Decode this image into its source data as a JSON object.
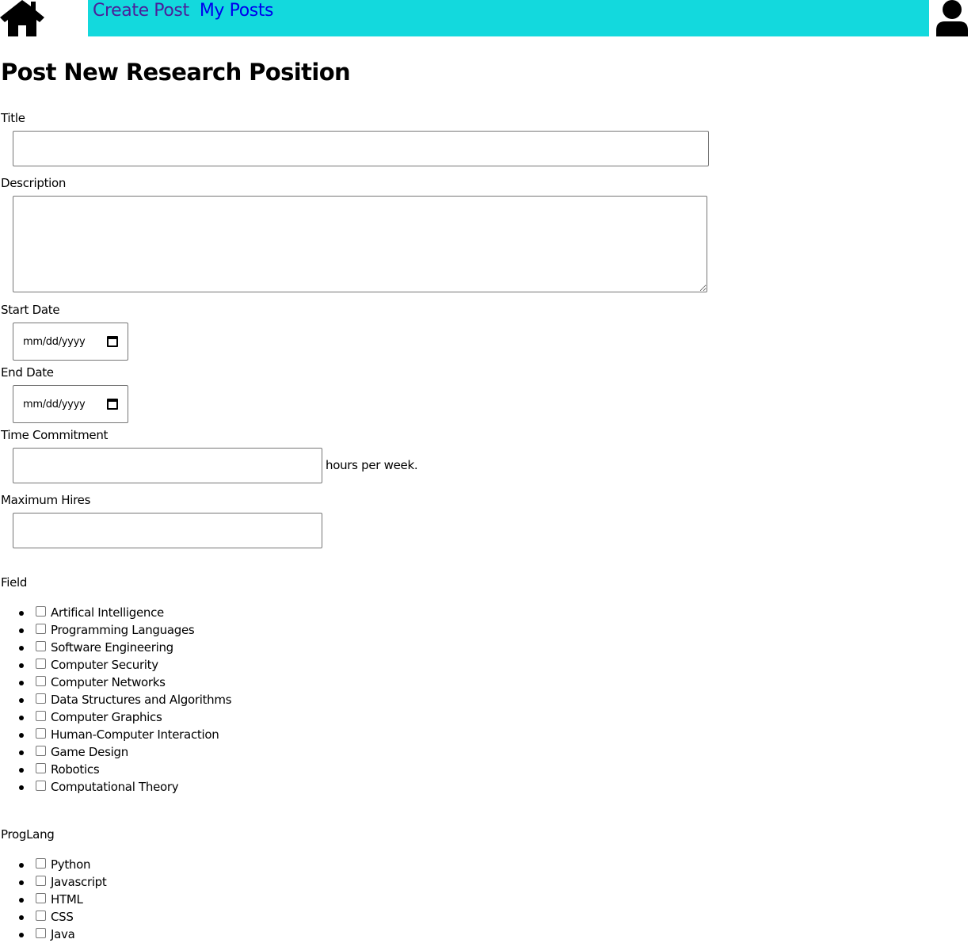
{
  "nav": {
    "home_icon": "home-icon",
    "create_post": "Create Post",
    "my_posts": "My Posts",
    "user_icon": "user-icon",
    "bar_color": "#13d9dd"
  },
  "page_title": "Post New Research Position",
  "form": {
    "title_label": "Title",
    "title_value": "",
    "description_label": "Description",
    "description_value": "",
    "start_date_label": "Start Date",
    "start_date_placeholder": "mm/dd/yyyy",
    "end_date_label": "End Date",
    "end_date_placeholder": "mm/dd/yyyy",
    "time_commitment_label": "Time Commitment",
    "time_commitment_value": "",
    "time_commitment_suffix": "hours per week.",
    "max_hires_label": "Maximum Hires",
    "max_hires_value": "",
    "field_label": "Field",
    "fields": [
      "Artifical Intelligence",
      "Programming Languages",
      "Software Engineering",
      "Computer Security",
      "Computer Networks",
      "Data Structures and Algorithms",
      "Computer Graphics",
      "Human-Computer Interaction",
      "Game Design",
      "Robotics",
      "Computational Theory"
    ],
    "proglang_label": "ProgLang",
    "proglangs": [
      "Python",
      "Javascript",
      "HTML",
      "CSS",
      "Java"
    ]
  }
}
